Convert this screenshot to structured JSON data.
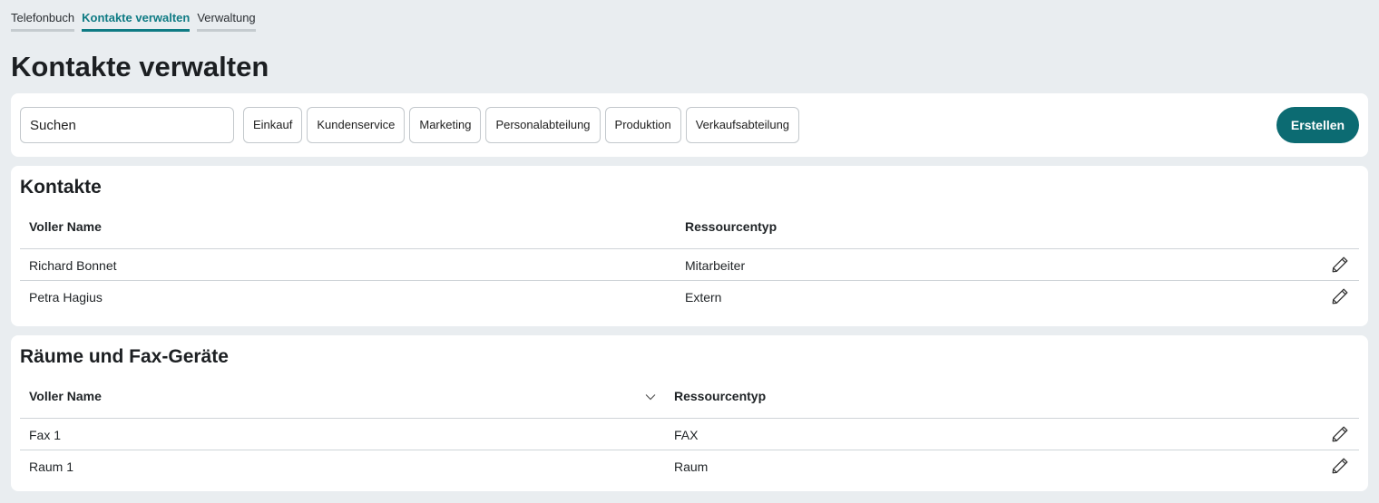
{
  "nav": {
    "tabs": [
      {
        "label": "Telefonbuch"
      },
      {
        "label": "Kontakte verwalten"
      },
      {
        "label": "Verwaltung"
      }
    ]
  },
  "page": {
    "title": "Kontakte verwalten"
  },
  "toolbar": {
    "search_value": "Suchen",
    "filters": [
      "Einkauf",
      "Kundenservice",
      "Marketing",
      "Personalabteilung",
      "Produktion",
      "Verkaufsabteilung"
    ],
    "create_label": "Erstellen"
  },
  "contacts": {
    "title": "Kontakte",
    "columns": [
      "Voller Name",
      "Ressourcentyp"
    ],
    "rows": [
      {
        "name": "Richard Bonnet",
        "type": "Mitarbeiter"
      },
      {
        "name": "Petra Hagius",
        "type": "Extern"
      }
    ]
  },
  "rooms": {
    "title": "Räume und Fax-Geräte",
    "columns": [
      "Voller Name",
      "Ressourcentyp"
    ],
    "rows": [
      {
        "name": "Fax 1",
        "type": "FAX"
      },
      {
        "name": "Raum 1",
        "type": "Raum"
      }
    ]
  },
  "colors": {
    "accent": "#0f7b84",
    "button": "#0c6b72",
    "background": "#e9edf0"
  },
  "icons": {
    "edit": "pencil-icon",
    "sort": "chevron-down-icon"
  }
}
